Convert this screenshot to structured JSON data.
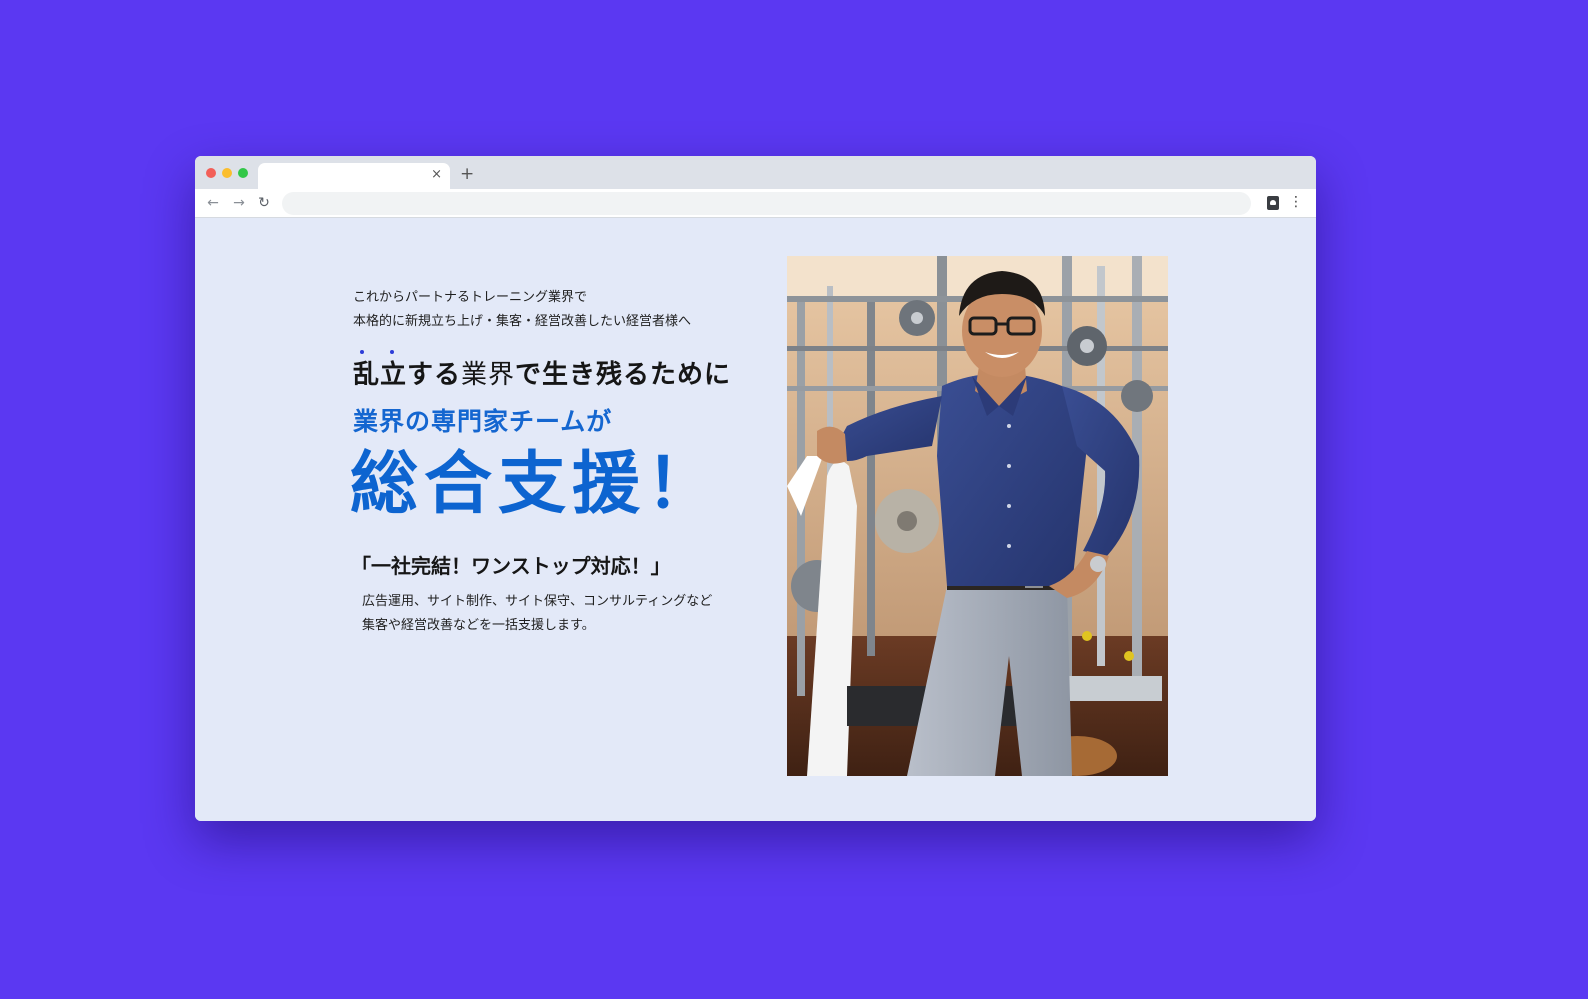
{
  "browser": {
    "tab_close": "×",
    "new_tab": "+",
    "back": "←",
    "forward": "→",
    "reload": "↻",
    "menu": "⋮",
    "url": ""
  },
  "hero": {
    "intro_line1": "これからパートナるトレーニング業界で",
    "intro_line2": "本格的に新規立ち上げ・集客・経営改善したい経営者様へ",
    "headline_a": "乱立する",
    "headline_b": "業界",
    "headline_c": "で生き残るために",
    "sub_headline": "業界の専門家チームが",
    "big_title": "総合支援！",
    "tagline": "「一社完結！ワンストップ対応！」",
    "desc_line1": "広告運用、サイト制作、サイト保守、コンサルティングなど",
    "desc_line2": "集客や経営改善などを一括支援します。"
  },
  "colors": {
    "background": "#5b38f2",
    "page": "#e3e9f8",
    "accent_blue": "#1466d0",
    "title_blue": "#0d64d0"
  },
  "icons": {
    "extension": "clipboard-person-icon",
    "menu": "kebab-menu-icon"
  }
}
